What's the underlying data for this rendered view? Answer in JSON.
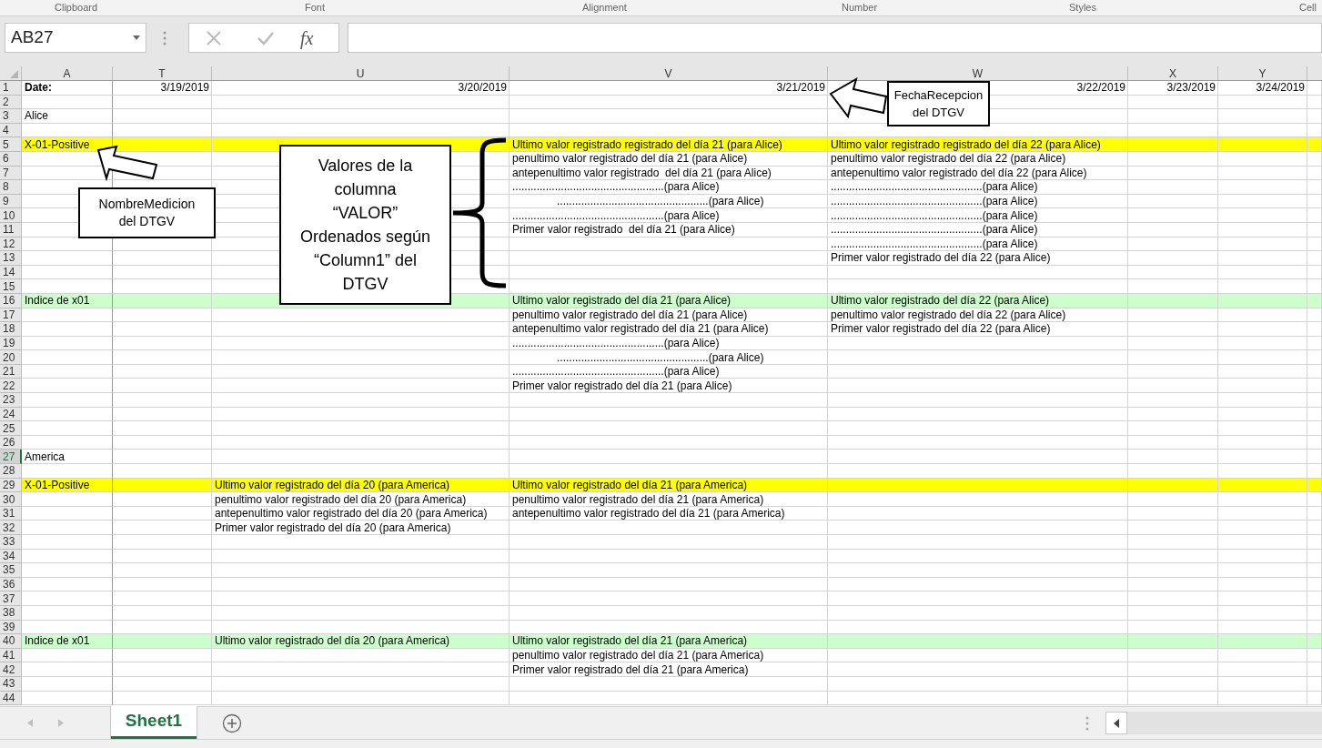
{
  "ribbon_groups": [
    "Clipboard",
    "Font",
    "Alignment",
    "Number",
    "Styles",
    "Cell"
  ],
  "name_box": {
    "value": "AB27"
  },
  "formula_bar": {
    "fx": "fx"
  },
  "columns": [
    "A",
    "T",
    "U",
    "V",
    "W",
    "X",
    "Y"
  ],
  "rows": [
    {
      "number": "1",
      "selected": false,
      "cells": [
        {
          "kind": "label",
          "text": "Date:"
        },
        {
          "kind": "date",
          "text": "3/19/2019"
        },
        {
          "kind": "date",
          "text": "3/20/2019"
        },
        {
          "kind": "date",
          "text": "3/21/2019"
        },
        {
          "kind": "date",
          "text": "3/22/2019"
        },
        {
          "kind": "date",
          "text": "3/23/2019"
        },
        {
          "kind": "date",
          "text": "3/24/2019"
        }
      ]
    },
    {
      "number": "2",
      "selected": false
    },
    {
      "number": "3",
      "selected": false,
      "cells": [
        {
          "kind": "text",
          "text": "Alice"
        }
      ]
    },
    {
      "number": "4",
      "selected": false
    },
    {
      "number": "5",
      "selected": false,
      "color": "#ffff00",
      "cells": [
        {
          "kind": "text",
          "text": "X-01-Positive"
        },
        null,
        null,
        {
          "kind": "text",
          "text": "Ultimo valor registrado registrado del día 21 (para Alice)"
        },
        {
          "kind": "text",
          "text": "Ultimo valor registrado registrado del día 22 (para Alice)"
        }
      ]
    },
    {
      "number": "6",
      "selected": false,
      "cells": [
        null,
        null,
        null,
        {
          "kind": "text",
          "text": "penultimo valor registrado del día 21 (para Alice)"
        },
        {
          "kind": "text",
          "text": "penultimo valor registrado del día 22 (para Alice)"
        }
      ]
    },
    {
      "number": "7",
      "selected": false,
      "cells": [
        null,
        null,
        null,
        {
          "kind": "text",
          "text": "antepenultimo valor registrado  del día 21 (para Alice)"
        },
        {
          "kind": "text",
          "text": "antepenultimo valor registrado del día 22 (para Alice)"
        }
      ]
    },
    {
      "number": "8",
      "selected": false,
      "cells": [
        null,
        null,
        null,
        {
          "kind": "text",
          "text": "..................................................(para Alice)"
        },
        {
          "kind": "text",
          "text": "..................................................(para Alice)"
        }
      ]
    },
    {
      "number": "9",
      "selected": false,
      "cells": [
        null,
        null,
        null,
        {
          "kind": "indented",
          "text": "..................................................(para Alice)"
        },
        {
          "kind": "text",
          "text": "..................................................(para Alice)"
        }
      ]
    },
    {
      "number": "10",
      "selected": false,
      "cells": [
        null,
        null,
        null,
        {
          "kind": "text",
          "text": "..................................................(para Alice)"
        },
        {
          "kind": "text",
          "text": "..................................................(para Alice)"
        }
      ]
    },
    {
      "number": "11",
      "selected": false,
      "cells": [
        null,
        null,
        null,
        {
          "kind": "text",
          "text": "Primer valor registrado  del día 21 (para Alice)"
        },
        {
          "kind": "text",
          "text": "..................................................(para Alice)"
        }
      ]
    },
    {
      "number": "12",
      "selected": false,
      "cells": [
        null,
        null,
        null,
        null,
        {
          "kind": "text",
          "text": "..................................................(para Alice)"
        }
      ]
    },
    {
      "number": "13",
      "selected": false,
      "cells": [
        null,
        null,
        null,
        null,
        {
          "kind": "text",
          "text": "Primer valor registrado del día 22 (para Alice)"
        }
      ]
    },
    {
      "number": "14",
      "selected": false
    },
    {
      "number": "15",
      "selected": false
    },
    {
      "number": "16",
      "selected": false,
      "color": "#ccffcc",
      "cells": [
        {
          "kind": "text",
          "text": "Indice de x01"
        },
        null,
        null,
        {
          "kind": "text",
          "text": "Ultimo valor registrado del día 21 (para Alice)"
        },
        {
          "kind": "text",
          "text": "Ultimo valor registrado del día 22 (para Alice)"
        }
      ]
    },
    {
      "number": "17",
      "selected": false,
      "cells": [
        null,
        null,
        null,
        {
          "kind": "text",
          "text": "penultimo valor registrado del día 21 (para Alice)"
        },
        {
          "kind": "text",
          "text": "penultimo valor registrado del día 22 (para Alice)"
        }
      ]
    },
    {
      "number": "18",
      "selected": false,
      "cells": [
        null,
        null,
        null,
        {
          "kind": "text",
          "text": "antepenultimo valor registrado del día 21 (para Alice)"
        },
        {
          "kind": "text",
          "text": "Primer valor registrado del día 22 (para Alice)"
        }
      ]
    },
    {
      "number": "19",
      "selected": false,
      "cells": [
        null,
        null,
        null,
        {
          "kind": "text",
          "text": "..................................................(para Alice)"
        }
      ]
    },
    {
      "number": "20",
      "selected": false,
      "cells": [
        null,
        null,
        null,
        {
          "kind": "indented",
          "text": "..................................................(para Alice)"
        }
      ]
    },
    {
      "number": "21",
      "selected": false,
      "cells": [
        null,
        null,
        null,
        {
          "kind": "text",
          "text": "..................................................(para Alice)"
        }
      ]
    },
    {
      "number": "22",
      "selected": false,
      "cells": [
        null,
        null,
        null,
        {
          "kind": "text",
          "text": "Primer valor registrado del día 21 (para Alice)"
        }
      ]
    },
    {
      "number": "23",
      "selected": false
    },
    {
      "number": "24",
      "selected": false
    },
    {
      "number": "25",
      "selected": false
    },
    {
      "number": "26",
      "selected": false
    },
    {
      "number": "27",
      "selected": true,
      "cells": [
        {
          "kind": "text",
          "text": "America"
        }
      ]
    },
    {
      "number": "28",
      "selected": false
    },
    {
      "number": "29",
      "selected": false,
      "color": "#ffff00",
      "cells": [
        {
          "kind": "text",
          "text": "X-01-Positive"
        },
        null,
        {
          "kind": "text",
          "text": "Ultimo valor registrado del día 20 (para America)"
        },
        {
          "kind": "text",
          "text": "Ultimo valor registrado del día 21 (para America)"
        }
      ]
    },
    {
      "number": "30",
      "selected": false,
      "cells": [
        null,
        null,
        {
          "kind": "text",
          "text": "penultimo valor registrado del día 20 (para America)"
        },
        {
          "kind": "text",
          "text": "penultimo valor registrado del día 21 (para America)"
        }
      ]
    },
    {
      "number": "31",
      "selected": false,
      "cells": [
        null,
        null,
        {
          "kind": "text",
          "text": "antepenultimo valor registrado del día 20 (para America)"
        },
        {
          "kind": "text",
          "text": "antepenultimo valor registrado del día 21 (para America)"
        }
      ]
    },
    {
      "number": "32",
      "selected": false,
      "cells": [
        null,
        null,
        {
          "kind": "text",
          "text": "Primer valor registrado del día 20 (para America)"
        }
      ]
    },
    {
      "number": "33",
      "selected": false
    },
    {
      "number": "34",
      "selected": false
    },
    {
      "number": "35",
      "selected": false
    },
    {
      "number": "36",
      "selected": false
    },
    {
      "number": "37",
      "selected": false
    },
    {
      "number": "38",
      "selected": false
    },
    {
      "number": "39",
      "selected": false
    },
    {
      "number": "40",
      "selected": false,
      "color": "#ccffcc",
      "cells": [
        {
          "kind": "text",
          "text": "Indice de x01"
        },
        null,
        {
          "kind": "text",
          "text": "Ultimo valor registrado del día 20 (para America)"
        },
        {
          "kind": "text",
          "text": "Ultimo valor registrado del día 21 (para America)"
        }
      ]
    },
    {
      "number": "41",
      "selected": false,
      "cells": [
        null,
        null,
        null,
        {
          "kind": "text",
          "text": "penultimo valor registrado del día 21 (para America)"
        }
      ]
    },
    {
      "number": "42",
      "selected": false,
      "cells": [
        null,
        null,
        null,
        {
          "kind": "text",
          "text": "Primer valor registrado del día 21 (para America)"
        }
      ]
    },
    {
      "number": "43",
      "selected": false
    },
    {
      "number": "44",
      "selected": false
    }
  ],
  "callouts": [
    {
      "kind": "arrow-up-left",
      "text": "NombreMedicion\ndel DTGV"
    },
    {
      "kind": "brace",
      "text": "Valores de la\ncolumna\n“VALOR”\nOrdenados según\n“Column1” del\nDTGV"
    },
    {
      "kind": "arrow-left",
      "text": "FechaRecepcion\ndel DTGV"
    }
  ],
  "sheet_tabs": [
    {
      "label": "Sheet1",
      "selected": true
    }
  ]
}
